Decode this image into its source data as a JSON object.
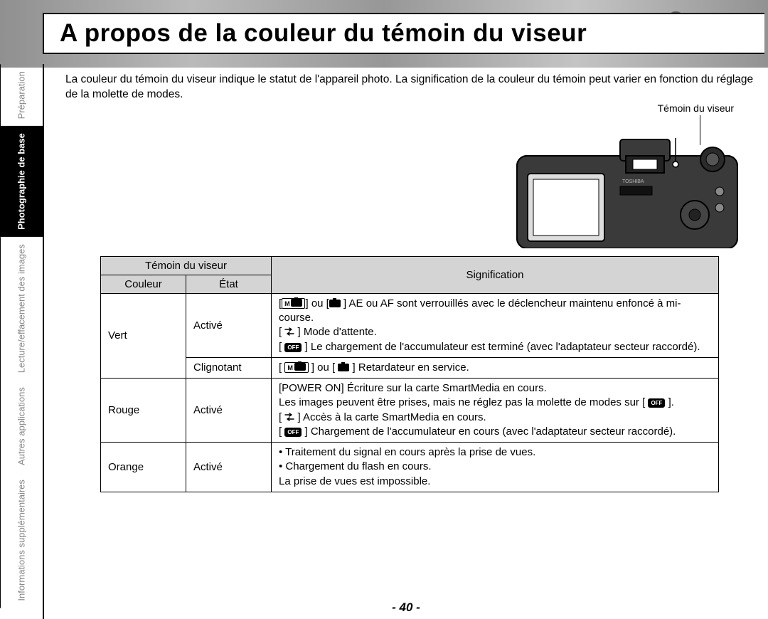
{
  "title": "A propos de la couleur du témoin du viseur",
  "intro": "La couleur du témoin du viseur indique le statut de l'appareil photo. La signification de la couleur du témoin peut varier en fonction du réglage de la molette de modes.",
  "callout_label": "Témoin du viseur",
  "sidebar": {
    "items": [
      {
        "label": "Préparation",
        "active": false
      },
      {
        "label": "Photographie de base",
        "active": true
      },
      {
        "label": "Lecture/effacement des images",
        "active": false
      },
      {
        "label": "Autres applications",
        "active": false
      },
      {
        "label": "Informations supplémentaires",
        "active": false
      }
    ]
  },
  "table": {
    "head_group": "Témoin du viseur",
    "head_color": "Couleur",
    "head_state": "État",
    "head_sig": "Signification",
    "rows": [
      {
        "color": "Vert",
        "state": "Activé",
        "sig_lines": [
          {
            "prefix": "[",
            "icons": [
              "M-cam"
            ],
            "mid": "] ou [",
            "icons2": [
              "cam"
            ],
            "suffix": " ] AE ou AF sont verrouillés avec le déclencheur maintenu enfoncé à mi-course."
          },
          {
            "prefix": "[ ",
            "icons": [
              "pc"
            ],
            "suffix": " ] Mode d'attente."
          },
          {
            "prefix": "[ ",
            "icons": [
              "off"
            ],
            "suffix": " ] Le chargement de l'accumulateur est terminé (avec l'adaptateur secteur raccordé)."
          }
        ]
      },
      {
        "color": "",
        "state": "Clignotant",
        "sig_lines": [
          {
            "prefix": "[ ",
            "icons": [
              "M-cam"
            ],
            "mid": " ] ou [ ",
            "icons2": [
              "cam"
            ],
            "suffix": " ] Retardateur en service."
          }
        ]
      },
      {
        "color": "Rouge",
        "state": "Activé",
        "sig_lines": [
          {
            "plain": "[POWER ON] Écriture sur la carte SmartMedia en cours."
          },
          {
            "plain_pre": "Les images peuvent être prises, mais ne réglez pas la molette de modes sur [ ",
            "icons": [
              "off"
            ],
            "plain_post": " ]."
          },
          {
            "prefix": "[ ",
            "icons": [
              "pc"
            ],
            "suffix": " ] Accès à la carte SmartMedia en cours."
          },
          {
            "prefix": "[ ",
            "icons": [
              "off"
            ],
            "suffix": " ] Chargement de l'accumulateur en cours (avec l'adaptateur secteur raccordé)."
          }
        ]
      },
      {
        "color": "Orange",
        "state": "Activé",
        "sig_lines": [
          {
            "plain": "• Traitement du signal en cours après la prise de vues."
          },
          {
            "plain": "• Chargement du flash en cours."
          },
          {
            "plain": "La prise de vues est impossible."
          }
        ]
      }
    ]
  },
  "page_number": "- 40 -"
}
